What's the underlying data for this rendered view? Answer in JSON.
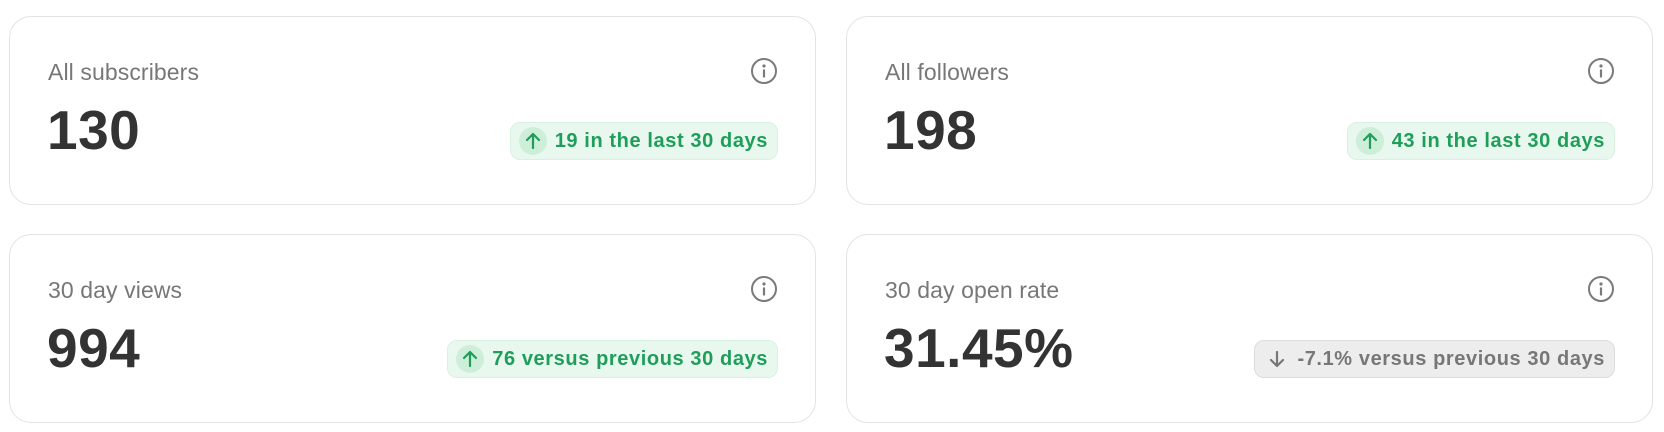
{
  "colors": {
    "positive": "#1f9e5a",
    "positive_bg": "#e9f8ef",
    "neutral": "#777777",
    "neutral_bg": "#ededed",
    "value_text": "#333333"
  },
  "cards": [
    {
      "label": "All subscribers",
      "value": "130",
      "info_icon": "info-circle-icon",
      "trend": {
        "direction": "up",
        "icon": "arrow-up-icon",
        "text": "19 in the last 30 days"
      }
    },
    {
      "label": "All followers",
      "value": "198",
      "info_icon": "info-circle-icon",
      "trend": {
        "direction": "up",
        "icon": "arrow-up-icon",
        "text": "43 in the last 30 days"
      }
    },
    {
      "label": "30 day views",
      "value": "994",
      "info_icon": "info-circle-icon",
      "trend": {
        "direction": "up",
        "icon": "arrow-up-icon",
        "text": "76 versus previous 30 days"
      }
    },
    {
      "label": "30 day open rate",
      "value": "31.45%",
      "info_icon": "info-circle-icon",
      "trend": {
        "direction": "down",
        "icon": "arrow-down-icon",
        "text": "-7.1% versus previous 30 days"
      }
    }
  ]
}
